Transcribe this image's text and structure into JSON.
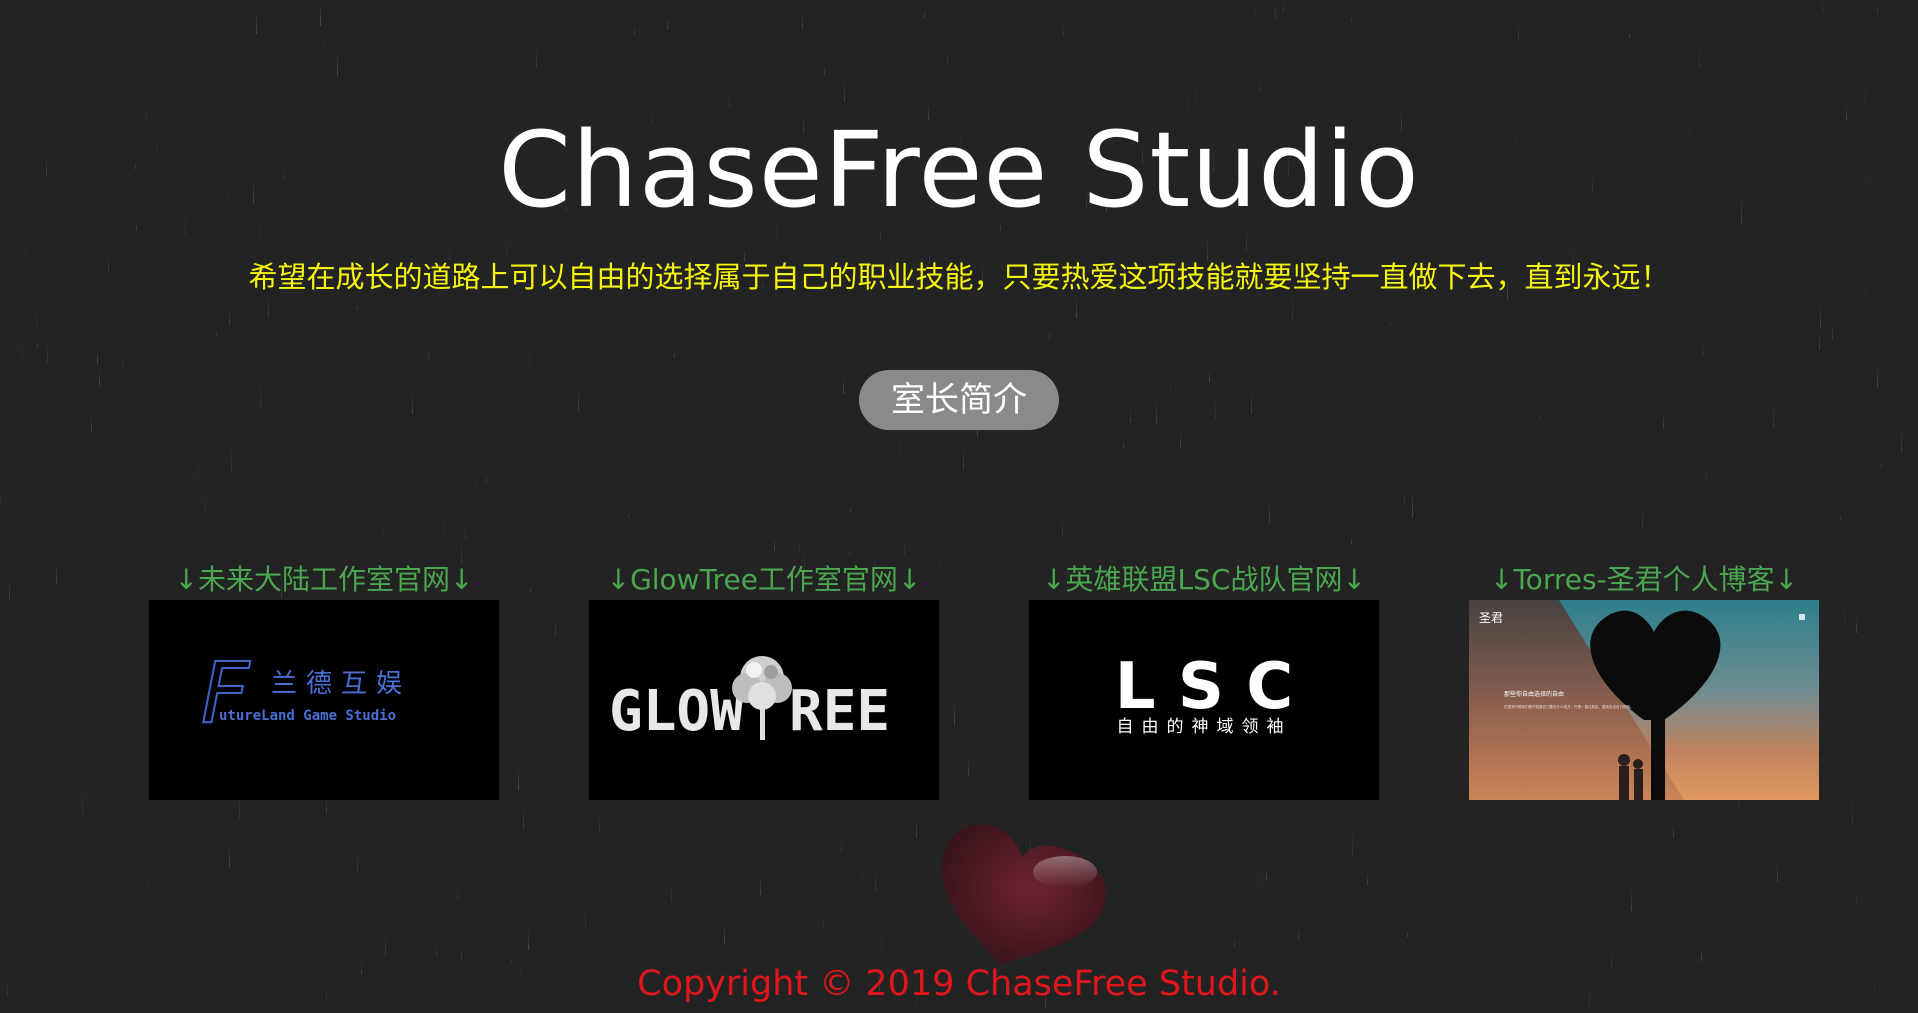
{
  "header": {
    "title": "ChaseFree Studio",
    "motto": "希望在成长的道路上可以自由的选择属于自己的职业技能，只要热爱这项技能就要坚持一直做下去，直到永远！"
  },
  "intro_button": {
    "label": "室长简介"
  },
  "links": [
    {
      "label": "↓未来大陆工作室官网↓",
      "logo_cn": "兰德互娱",
      "logo_en": "utureLand Game Studio",
      "logo_letter": "F"
    },
    {
      "label": "↓GlowTree工作室官网↓",
      "logo_left": "GLOW",
      "logo_right": "REE"
    },
    {
      "label": "↓英雄联盟LSC战队官网↓",
      "logo_main": "L S C",
      "logo_sub": "自由的神域领袖"
    },
    {
      "label": "↓Torres-圣君个人博客↓",
      "blog_name": "圣君",
      "blog_heading": "那些你自由选择的自由",
      "blog_text": "在很多时候我们都不知道自己要去什么地方，只是一直往前走，直到走出自己的路。"
    }
  ],
  "footer": {
    "copyright": "Copyright © 2019 ChaseFree Studio."
  },
  "colors": {
    "background": "#232323",
    "title": "#ffffff",
    "motto": "#f4f40c",
    "link_label": "#4aa64f",
    "copyright": "#e0161b",
    "button_bg": "#8a8a8a"
  }
}
